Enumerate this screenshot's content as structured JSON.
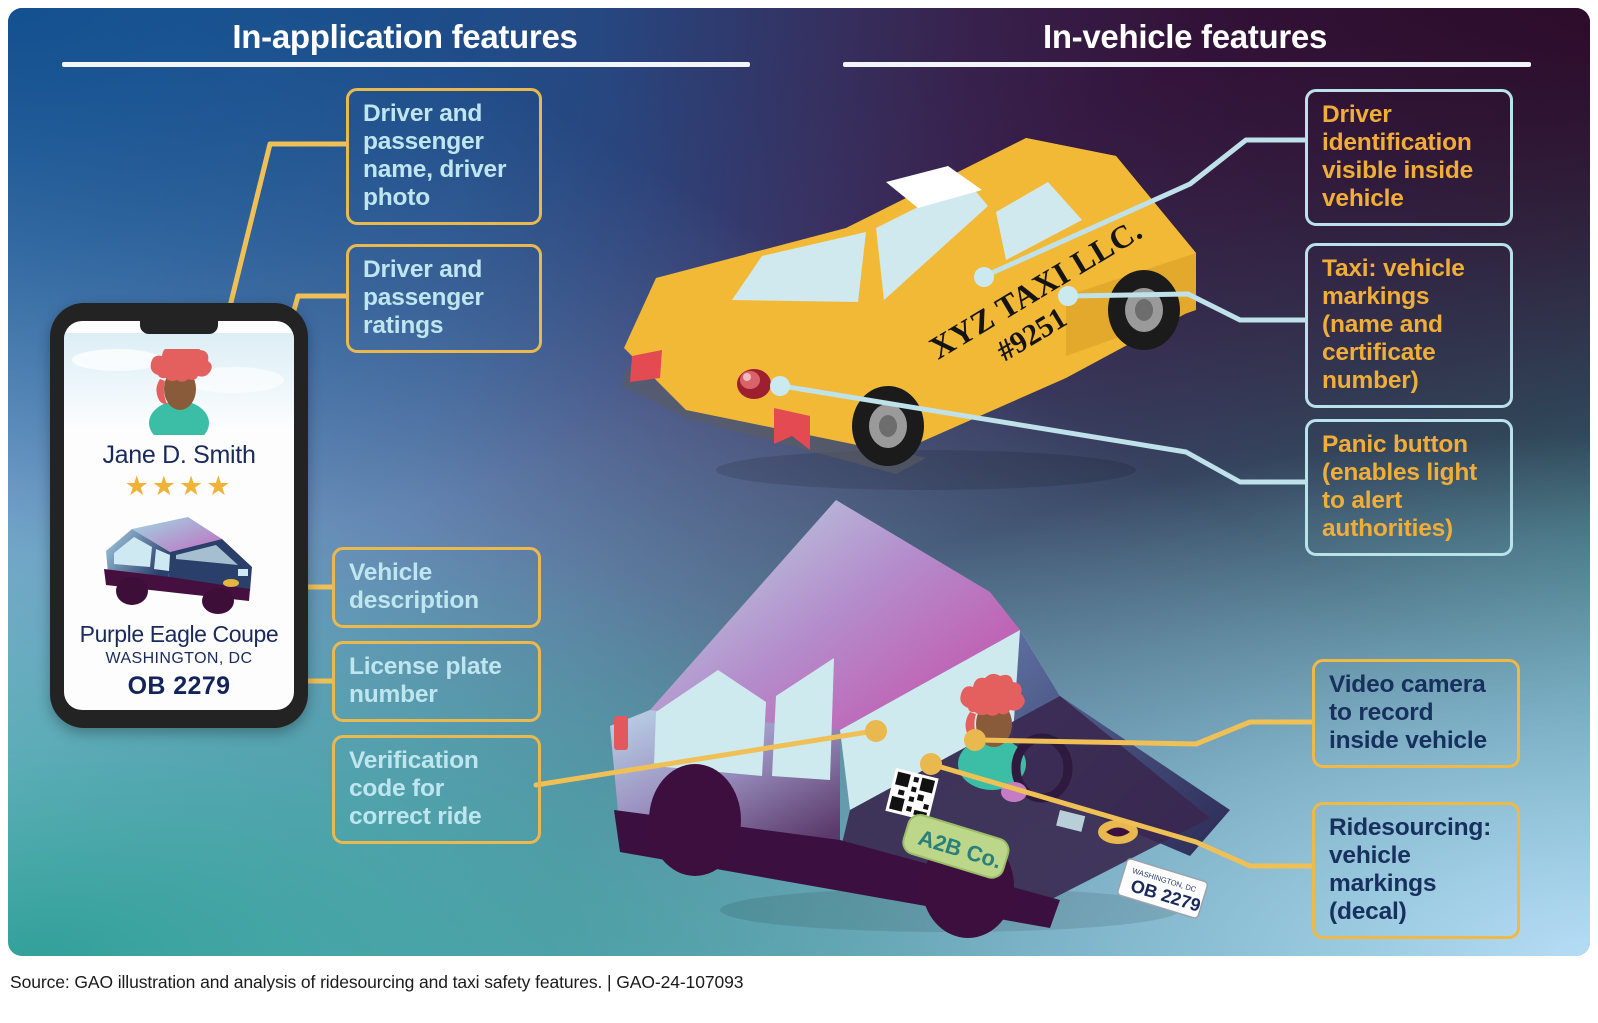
{
  "headers": {
    "left": "In-application features",
    "right": "In-vehicle features"
  },
  "callouts_left": [
    {
      "id": "driver-passenger-name-photo",
      "text": "Driver and passenger name, driver photo"
    },
    {
      "id": "driver-passenger-ratings",
      "text": "Driver and passenger ratings"
    },
    {
      "id": "vehicle-description",
      "text": "Vehicle description"
    },
    {
      "id": "license-plate-number",
      "text": "License plate number"
    },
    {
      "id": "verification-code",
      "text": "Verification code for correct ride"
    }
  ],
  "callouts_right": [
    {
      "id": "driver-identification",
      "text": "Driver identification visible inside vehicle"
    },
    {
      "id": "taxi-vehicle-markings",
      "text": "Taxi: vehicle markings (name and certificate number)"
    },
    {
      "id": "panic-button",
      "text": "Panic button (enables light to alert authorities)"
    },
    {
      "id": "video-camera",
      "text": "Video camera to record inside vehicle"
    },
    {
      "id": "ridesourcing-markings",
      "text": "Ridesourcing: vehicle markings (decal)"
    }
  ],
  "phone": {
    "driver_name": "Jane D. Smith",
    "rating_stars": "★★★★",
    "rating_value": 4,
    "rating_max": 5,
    "vehicle_description": "Purple Eagle Coupe",
    "city": "WASHINGTON, DC",
    "plate": "OB 2279"
  },
  "taxi": {
    "company": "XYZ TAXI LLC.",
    "certificate_number": "#9251"
  },
  "ridesourcing": {
    "decal": "A2B Co.",
    "plate_state": "WASHINGTON, DC",
    "plate": "OB 2279"
  },
  "source": "Source: GAO illustration and analysis of ridesourcing and taxi safety features.  |  GAO-24-107093",
  "colors": {
    "gao_blue": "#16508f",
    "plum": "#2d0a2a",
    "teal": "#339a95",
    "light_blue": "#b6dcf5",
    "orange_border": "#e9b94f",
    "cyan_border": "#b9e2ea",
    "callout_text_left": "#bfe6ef",
    "callout_text_right": "#f0ad38",
    "callout_text_dark": "#17305e",
    "taxi_yellow": "#f2b937",
    "star_gold": "#eeb337"
  }
}
